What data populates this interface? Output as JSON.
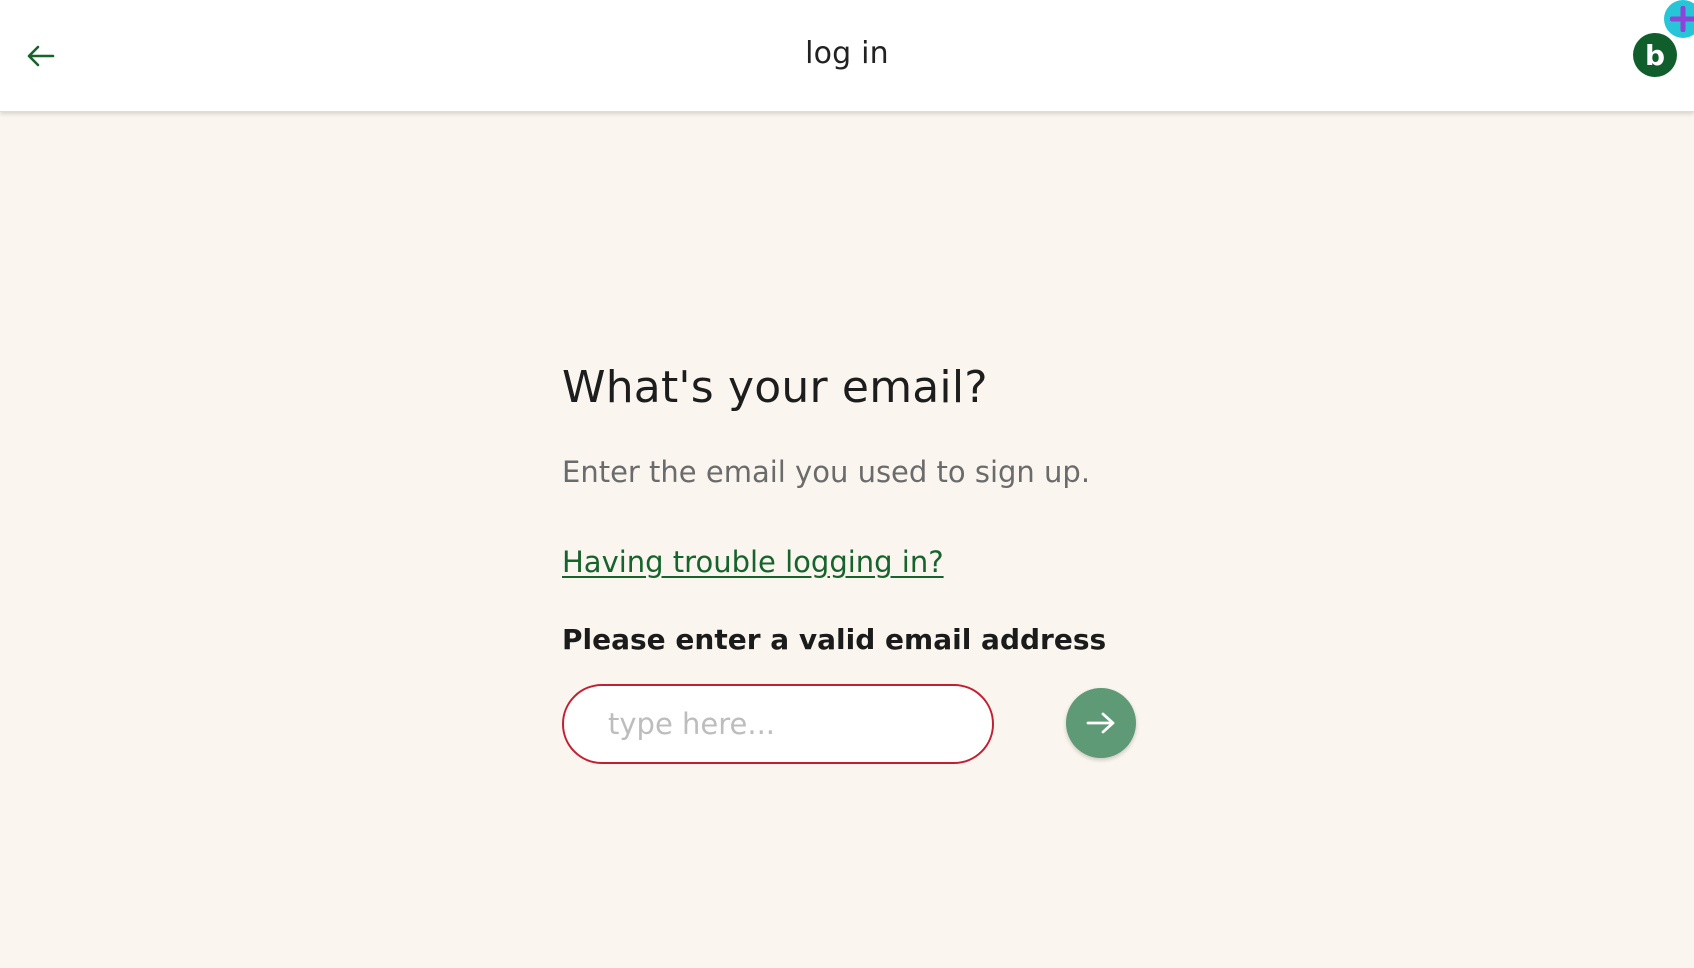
{
  "header": {
    "back_icon": "arrow-left-icon",
    "title": "log in",
    "avatar_letter": "b",
    "badge_icon": "plus-icon"
  },
  "colors": {
    "background": "#faf6ef",
    "header_background": "#ffffff",
    "accent_green": "#17632c",
    "avatar_green": "#0f5e2c",
    "button_green": "#5f9a76",
    "error_border": "#c21f33",
    "badge_cyan": "#26c6d8",
    "badge_plus": "#8e44d6"
  },
  "main": {
    "heading": "What's your email?",
    "subtext": "Enter the email you used to sign up.",
    "trouble_link": "Having trouble logging in?",
    "field_label": "Please enter a valid email address",
    "email_input": {
      "value": "",
      "placeholder": "type here..."
    },
    "submit_icon": "arrow-right-icon"
  }
}
